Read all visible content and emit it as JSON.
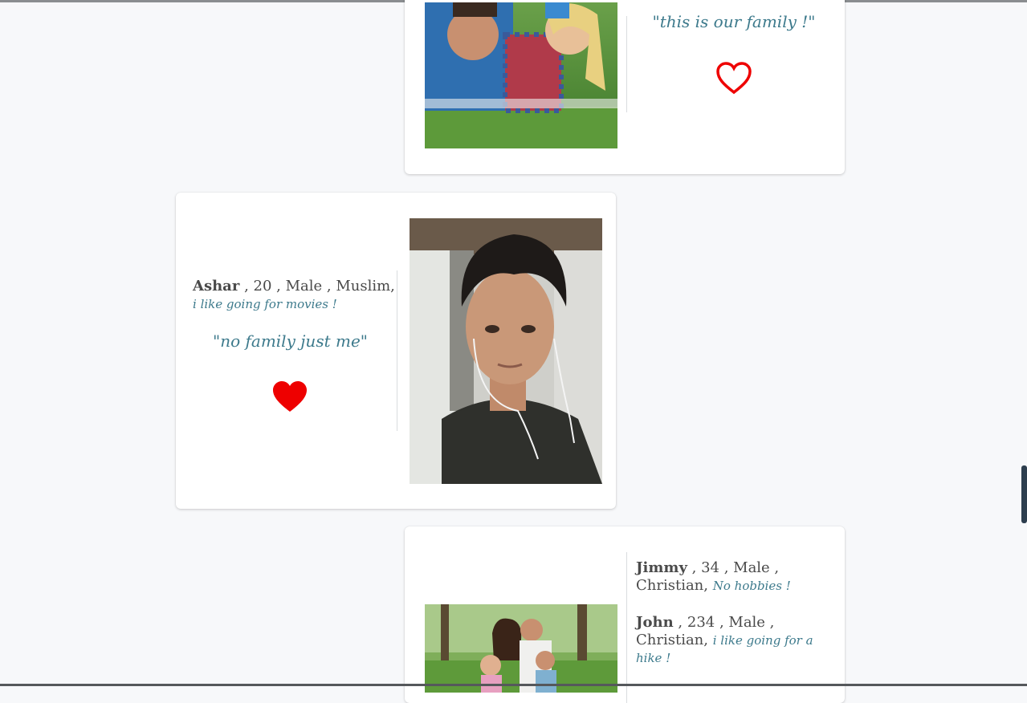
{
  "posts": [
    {
      "quote": "\"this is our family !\"",
      "heart_state": "outline",
      "photo": "family-couple-photo"
    },
    {
      "person": {
        "name": "Ashar",
        "details": " , 20 , Male , Muslim,",
        "hobby": "i like going for movies !"
      },
      "quote": "\"no family just me\"",
      "heart_state": "filled",
      "photo": "young-man-selfie"
    },
    {
      "people": [
        {
          "name": "Jimmy",
          "details": " , 34 , Male , Christian,",
          "hobby": "No hobbies !"
        },
        {
          "name": "John",
          "details": " , 234 , Male , Christian,",
          "hobby": "i like going for a hike !"
        }
      ],
      "photo": "family-park-photo"
    }
  ],
  "colors": {
    "heart": "#ee0000",
    "quote": "#3d7a8c",
    "background": "#f7f8fa"
  }
}
